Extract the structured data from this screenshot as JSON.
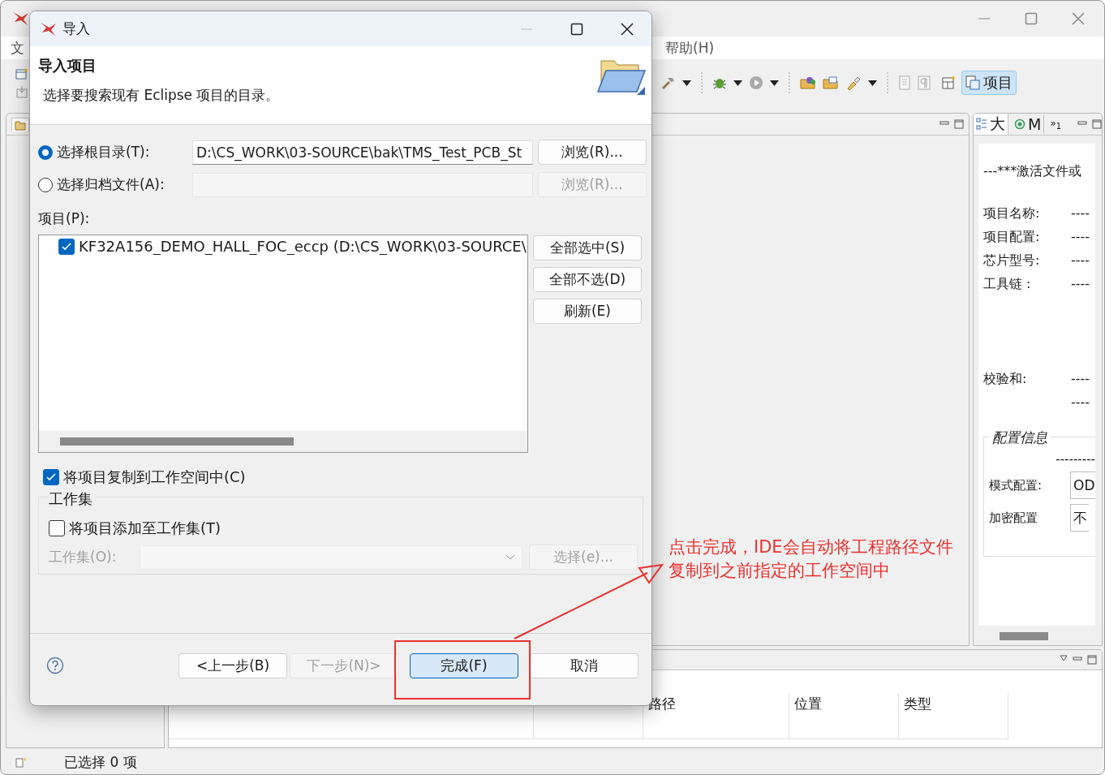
{
  "ide": {
    "menu_items": [
      {
        "label": "文"
      },
      {
        "label": "帮助(H)"
      }
    ],
    "perspective": {
      "label": "项目",
      "selected": true
    },
    "right_panel": {
      "tabs": [
        {
          "label": "大",
          "selected": true
        },
        {
          "label": "M",
          "selected": false
        }
      ],
      "overflow": {
        "chevron": "»",
        "count": "1"
      },
      "heading": "---***激活文件或",
      "fields": [
        {
          "label": "项目名称:",
          "value": "----"
        },
        {
          "label": "项目配置:",
          "value": "----"
        },
        {
          "label": "芯片型号:",
          "value": "----"
        },
        {
          "label": "工具链 :",
          "value": "----"
        }
      ],
      "checksum": {
        "label": "校验和:",
        "values": [
          "----",
          "----"
        ]
      },
      "config_group": {
        "title": "配置信息",
        "divider_text": "---------",
        "settings": [
          {
            "label": "模式配置:",
            "value": "OD"
          },
          {
            "label": "加密配置",
            "value": "不"
          }
        ]
      }
    },
    "problems_table": {
      "columns": [
        "路径",
        "位置",
        "类型"
      ]
    },
    "status_bar": {
      "text": "已选择 0 项"
    }
  },
  "dialog": {
    "title": "导入",
    "heading": "导入项目",
    "description": "选择要搜索现有 Eclipse 项目的目录。",
    "sources": [
      {
        "label": "选择根目录(T):",
        "selected": true,
        "value": "D:\\CS_WORK\\03-SOURCE\\bak\\TMS_Test_PCB_St",
        "button": "浏览(R)...",
        "disabled": false
      },
      {
        "label": "选择归档文件(A):",
        "selected": false,
        "button": "浏览(R)...",
        "disabled": true
      }
    ],
    "projects_label": "项目(P):",
    "projects": [
      {
        "label": "KF32A156_DEMO_HALL_FOC_eccp  (D:\\CS_WORK\\03-SOURCE\\",
        "checked": true
      }
    ],
    "project_buttons": [
      "全部选中(S)",
      "全部不选(D)",
      "刷新(E)"
    ],
    "copy_option": {
      "label": "将项目复制到工作空间中(C)",
      "checked": true
    },
    "working_set": {
      "title": "工作集",
      "add_option": {
        "label": "将项目添加至工作集(T)",
        "checked": false
      },
      "field_label": "工作集(O):",
      "button": "选择(e)...",
      "disabled": true
    },
    "buttons": [
      {
        "label": "<上一步(B)",
        "disabled": false,
        "default": false
      },
      {
        "label": "下一步(N)>",
        "disabled": true,
        "default": false
      },
      {
        "label": "完成(F)",
        "disabled": false,
        "default": true
      },
      {
        "label": "取消",
        "disabled": false,
        "default": false
      }
    ]
  },
  "annotation": {
    "lines": [
      "点击完成，IDE会自动将工程路径文件",
      "复制到之前指定的工作空间中"
    ]
  }
}
